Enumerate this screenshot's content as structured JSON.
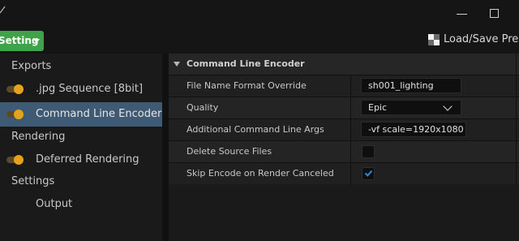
{
  "toolbar": {
    "setting_label": "Setting",
    "preset_label": "Load/Save Pres"
  },
  "sidebar": {
    "sections": [
      "Exports",
      "Rendering",
      "Settings"
    ],
    "items": [
      {
        "label": ".jpg Sequence [8bit]",
        "enabled": true
      },
      {
        "label": "Command Line Encoder",
        "enabled": true,
        "selected": true
      },
      {
        "label": "Deferred Rendering",
        "enabled": true
      },
      {
        "label": "Output"
      }
    ]
  },
  "panel": {
    "category": "Command Line Encoder",
    "rows": [
      {
        "label": "File Name Format Override",
        "value": "sh001_lighting"
      },
      {
        "label": "Quality",
        "value": "Epic"
      },
      {
        "label": "Additional Command Line Args",
        "value": "-vf scale=1920x1080"
      },
      {
        "label": "Delete Source Files",
        "checked": false
      },
      {
        "label": "Skip Encode on Render Canceled",
        "checked": true
      }
    ]
  },
  "colors": {
    "accent_green": "#3fa34a",
    "toggle_orange": "#e6a21a",
    "selection_blue": "#3f5a75",
    "check_blue": "#2b8ae0"
  }
}
